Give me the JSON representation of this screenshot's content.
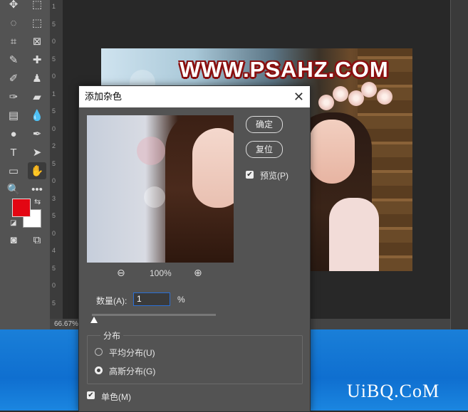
{
  "canvas": {
    "watermark": "WWW.PSAHZ.COM",
    "zoom_status": "66.67%",
    "ruler_ticks": [
      "1",
      "5",
      "0",
      "5",
      "0",
      "1",
      "5",
      "0",
      "2",
      "5",
      "0",
      "3",
      "5",
      "0",
      "4",
      "5",
      "0",
      "5"
    ]
  },
  "desktop": {
    "watermark": "UiBQ.CoM"
  },
  "toolbar": {
    "tools": [
      {
        "name": "move-tool",
        "glyph": "✥"
      },
      {
        "name": "marquee-tool",
        "glyph": "⬚"
      },
      {
        "name": "lasso-tool",
        "glyph": "◌"
      },
      {
        "name": "object-select-tool",
        "glyph": "⬚"
      },
      {
        "name": "crop-tool",
        "glyph": "⌗"
      },
      {
        "name": "frame-tool",
        "glyph": "⊠"
      },
      {
        "name": "eyedropper-tool",
        "glyph": "✎"
      },
      {
        "name": "healing-tool",
        "glyph": "✚"
      },
      {
        "name": "brush-tool",
        "glyph": "✐"
      },
      {
        "name": "stamp-tool",
        "glyph": "♟"
      },
      {
        "name": "history-brush-tool",
        "glyph": "✑"
      },
      {
        "name": "eraser-tool",
        "glyph": "▰"
      },
      {
        "name": "gradient-tool",
        "glyph": "▤"
      },
      {
        "name": "blur-tool",
        "glyph": "💧"
      },
      {
        "name": "dodge-tool",
        "glyph": "●"
      },
      {
        "name": "pen-tool",
        "glyph": "✒"
      },
      {
        "name": "type-tool",
        "glyph": "T"
      },
      {
        "name": "path-select-tool",
        "glyph": "➤"
      },
      {
        "name": "rectangle-tool",
        "glyph": "▭"
      },
      {
        "name": "hand-tool",
        "glyph": "✋"
      },
      {
        "name": "zoom-tool",
        "glyph": "🔍"
      },
      {
        "name": "more-tools",
        "glyph": "•••"
      },
      {
        "name": "quick-mask-tool",
        "glyph": "◙"
      },
      {
        "name": "screen-mode-tool",
        "glyph": "⧉"
      }
    ],
    "foreground_color": "#e30613",
    "background_color": "#ffffff"
  },
  "dialog": {
    "title": "添加杂色",
    "ok_label": "确定",
    "reset_label": "复位",
    "preview_label": "预览(P)",
    "zoom_value": "100%",
    "amount_label": "数量(A):",
    "amount_value": "1",
    "amount_unit": "%",
    "amount_slider_fraction": 0.01,
    "distribution": {
      "title": "分布",
      "uniform_label": "平均分布(U)",
      "gaussian_label": "高斯分布(G)",
      "selected": "gaussian"
    },
    "monochromatic_label": "单色(M)",
    "preview_checked": true,
    "monochromatic_checked": true
  }
}
